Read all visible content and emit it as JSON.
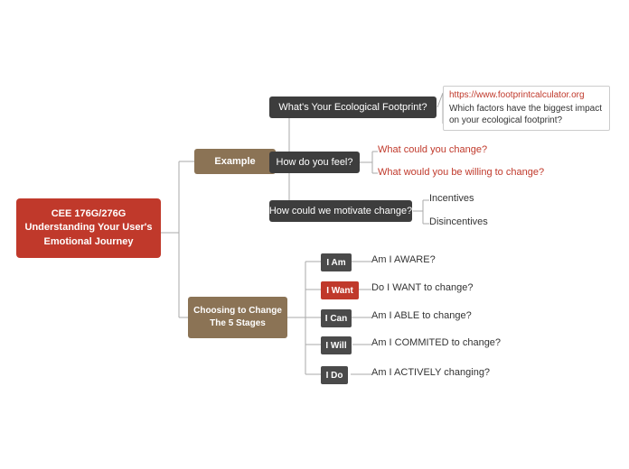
{
  "root": {
    "label": "CEE 176G/276G\nUnderstanding Your User's\nEmotional Journey",
    "line1": "CEE 176G/276G",
    "line2": "Understanding Your User's",
    "line3": "Emotional Journey"
  },
  "nodes": {
    "example": "Example",
    "choosing_line1": "Choosing to Change",
    "choosing_line2": "The 5 Stages",
    "footprint_q": "What's Your Ecological Footprint?",
    "feel_q": "How do you feel?",
    "motivate_q": "How could we motivate change?",
    "url": "https://www.footprintcalculator.org",
    "url_q": "Which factors have the biggest impact on your ecological footprint?",
    "what_change": "What could you change?",
    "willing_change": "What would you be willing to change?",
    "incentives": "Incentives",
    "disincentives": "Disincentives",
    "i_am_label": "I Am",
    "i_am_q": "Am I AWARE?",
    "i_want_label": "I Want",
    "i_want_q": "Do I WANT to change?",
    "i_can_label": "I Can",
    "i_can_q": "Am I ABLE to change?",
    "i_will_label": "I Will",
    "i_will_q": "Am I COMMITED to change?",
    "i_do_label": "I Do",
    "i_do_q": "Am I ACTIVELY changing?"
  },
  "colors": {
    "red": "#c0392b",
    "dark_brown": "#5a3e2b",
    "medium_brown": "#8B7355",
    "dark_node": "#3d3d3d",
    "line_color": "#888"
  }
}
